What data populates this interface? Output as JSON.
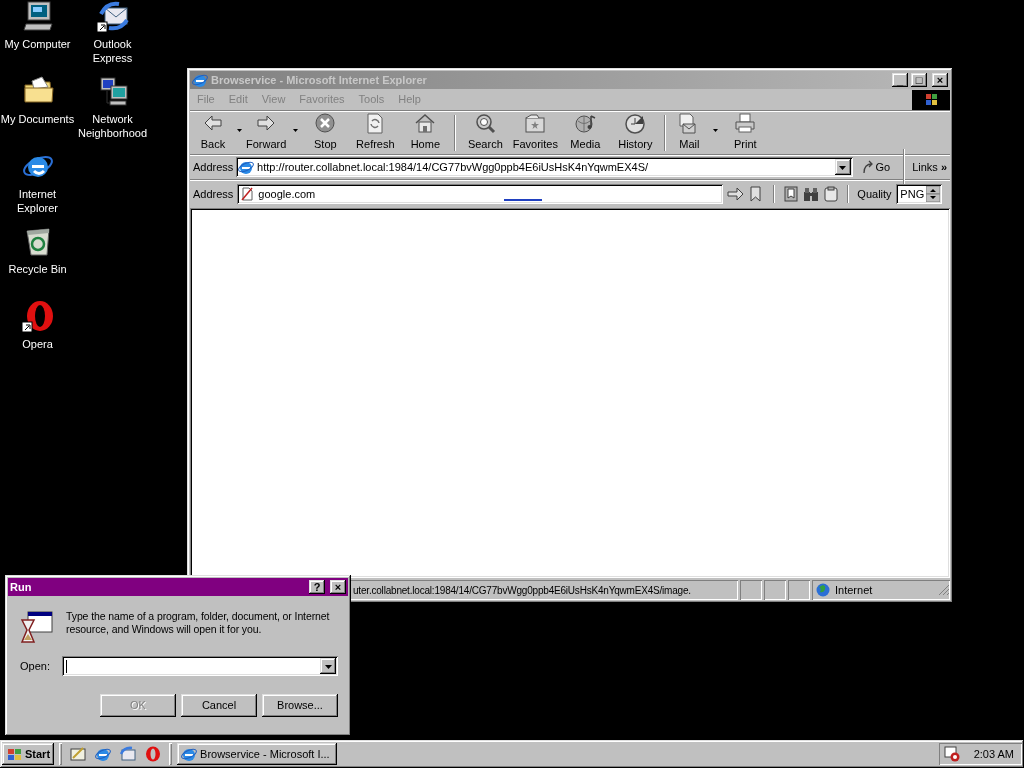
{
  "desktop_icons": [
    {
      "label": "My Computer",
      "shortcut": false
    },
    {
      "label": "Outlook Express",
      "shortcut": true
    },
    {
      "label": "My Documents",
      "shortcut": false
    },
    {
      "label": "Network Neighborhood",
      "shortcut": false
    },
    {
      "label": "Internet Explorer",
      "shortcut": false
    },
    {
      "label": "Recycle Bin",
      "shortcut": false
    },
    {
      "label": "Opera",
      "shortcut": true
    }
  ],
  "browser_window": {
    "title": "Browservice - Microsoft Internet Explorer",
    "active": false,
    "minimize": "_",
    "maximize": "□",
    "close": "×",
    "menu": [
      "File",
      "Edit",
      "View",
      "Favorites",
      "Tools",
      "Help"
    ],
    "toolbar": [
      {
        "buttons": [
          {
            "label": "Back",
            "dropdown": true
          },
          {
            "label": "Forward",
            "dropdown": true
          },
          {
            "label": "Stop",
            "dropdown": false
          },
          {
            "label": "Refresh",
            "dropdown": false
          },
          {
            "label": "Home",
            "dropdown": false
          }
        ]
      },
      {
        "buttons": [
          {
            "label": "Search",
            "dropdown": false
          },
          {
            "label": "Favorites",
            "dropdown": false
          },
          {
            "label": "Media",
            "dropdown": false
          },
          {
            "label": "History",
            "dropdown": false
          }
        ]
      },
      {
        "buttons": [
          {
            "label": "Mail",
            "dropdown": true
          },
          {
            "label": "Print",
            "dropdown": false
          }
        ]
      }
    ],
    "address_bar": {
      "label": "Address",
      "url": "http://router.collabnet.local:1984/14/CG77bvWgg0ppb4E6iUsHsK4nYqwmEX4S/",
      "go": "Go",
      "links": "Links",
      "more": "»"
    },
    "page_toolbar": {
      "label": "Address",
      "value": "google.com",
      "quality_label": "Quality",
      "quality_value": "PNG"
    },
    "status_bar": {
      "text": "uter.collabnet.local:1984/14/CG77bvWgg0ppb4E6iUsHsK4nYqwmEX4S/image.",
      "zone": "Internet"
    }
  },
  "run_dialog": {
    "title": "Run",
    "active": true,
    "help": "?",
    "close": "×",
    "message": "Type the name of a program, folder, document, or Internet resource, and Windows will open it for you.",
    "open_label": "Open:",
    "buttons": [
      {
        "label": "OK",
        "disabled": true
      },
      {
        "label": "Cancel",
        "disabled": false
      },
      {
        "label": "Browse...",
        "disabled": false
      }
    ]
  },
  "taskbar": {
    "start": "Start",
    "tasks": [
      {
        "label": "Browservice - Microsoft I...",
        "selected": false
      }
    ],
    "clock": "2:03 AM"
  }
}
